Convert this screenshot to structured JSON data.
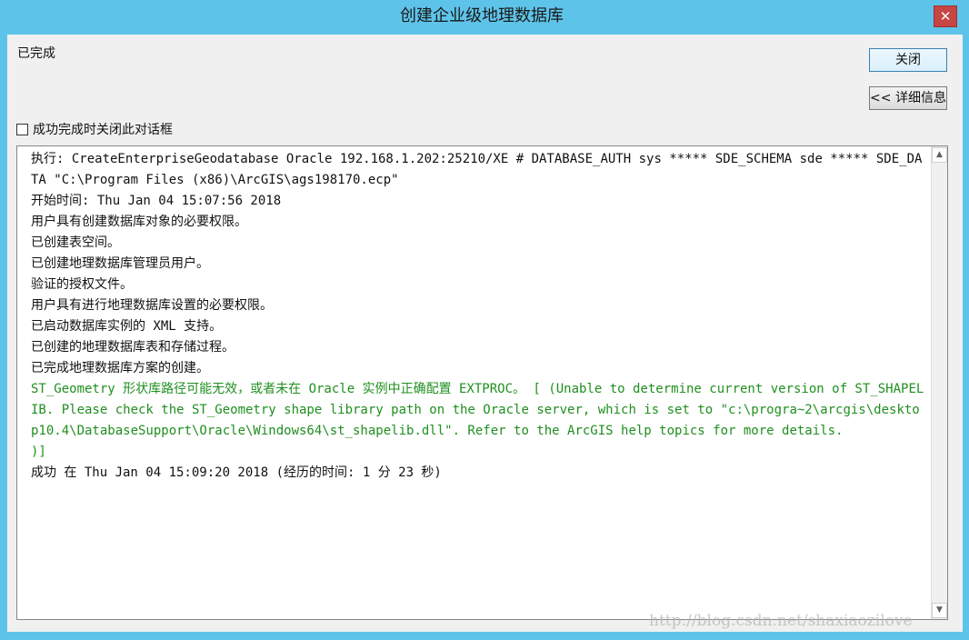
{
  "window": {
    "title": "创建企业级地理数据库",
    "close_glyph": "✕"
  },
  "status_text": "已完成",
  "buttons": {
    "close_label": "关闭",
    "details_label": "<< 详细信息"
  },
  "checkbox": {
    "label": "成功完成时关闭此对话框",
    "checked": false
  },
  "log": {
    "lines": [
      {
        "text": "执行: CreateEnterpriseGeodatabase Oracle 192.168.1.202:25210/XE # DATABASE_AUTH sys ***** SDE_SCHEMA sde ***** SDE_DATA \"C:\\Program Files (x86)\\ArcGIS\\ags198170.ecp\"",
        "color": "normal"
      },
      {
        "text": "开始时间: Thu Jan 04 15:07:56 2018",
        "color": "normal"
      },
      {
        "text": "用户具有创建数据库对象的必要权限。",
        "color": "normal"
      },
      {
        "text": "已创建表空间。",
        "color": "normal"
      },
      {
        "text": "已创建地理数据库管理员用户。",
        "color": "normal"
      },
      {
        "text": "验证的授权文件。",
        "color": "normal"
      },
      {
        "text": "用户具有进行地理数据库设置的必要权限。",
        "color": "normal"
      },
      {
        "text": "已启动数据库实例的 XML 支持。",
        "color": "normal"
      },
      {
        "text": "已创建的地理数据库表和存储过程。",
        "color": "normal"
      },
      {
        "text": "已完成地理数据库方案的创建。",
        "color": "normal"
      },
      {
        "text": "ST_Geometry 形状库路径可能无效，或者未在 Oracle 实例中正确配置 EXTPROC。 [ (Unable to determine current version of ST_SHAPELIB. Please check the ST_Geometry shape library path on the Oracle server, which is set to \"c:\\progra~2\\arcgis\\desktop10.4\\DatabaseSupport\\Oracle\\Windows64\\st_shapelib.dll\". Refer to the ArcGIS help topics for more details.",
        "color": "green"
      },
      {
        "text": ")]",
        "color": "green"
      },
      {
        "text": "成功 在 Thu Jan 04 15:09:20 2018 (经历的时间: 1 分 23 秒)",
        "color": "normal"
      }
    ]
  },
  "scrollbar": {
    "up_glyph": "▲",
    "down_glyph": "▼"
  },
  "watermark": "http://blog.csdn.net/shaxiaozilove",
  "colors": {
    "titlebar": "#5ec3e9",
    "warning_text": "#1f8f1f"
  }
}
